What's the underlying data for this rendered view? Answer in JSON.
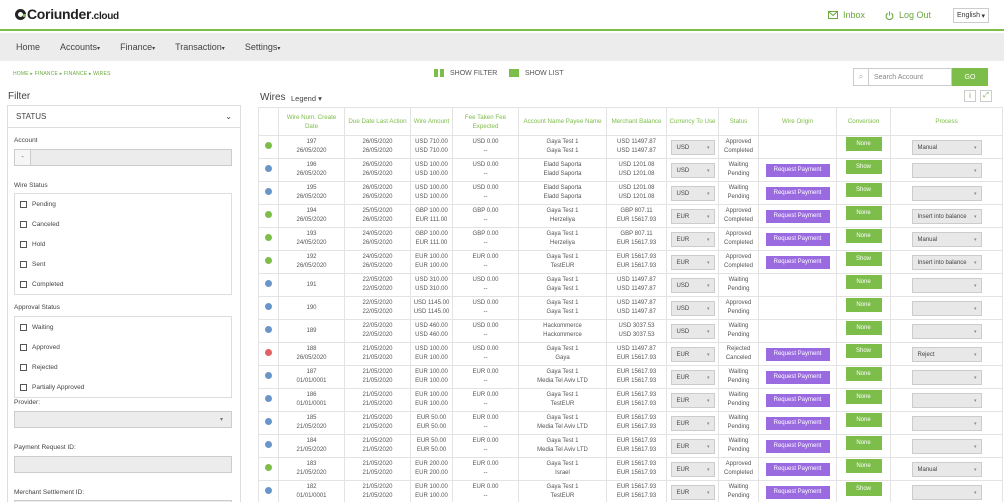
{
  "brand": {
    "name": "Coriunder",
    "suffix": ".cloud"
  },
  "header": {
    "inbox": "Inbox",
    "logout": "Log Out",
    "language": "English"
  },
  "nav": [
    "Home",
    "Accounts",
    "Finance",
    "Transaction",
    "Settings"
  ],
  "breadcrumb": "HOME  ▸  FINANCE  ▸  FINANCE  ▸  WIRES",
  "toolbar": {
    "show_filter": "SHOW FILTER",
    "show_list": "SHOW LIST",
    "search_placeholder": "Search Account",
    "go": "GO"
  },
  "filter": {
    "title": "Filter",
    "status_header": "STATUS",
    "account_label": "Account",
    "wire_status_label": "Wire Status",
    "wire_status_options": [
      "Pending",
      "Canceled",
      "Hold",
      "Sent",
      "Completed"
    ],
    "approval_status_label": "Approval Status",
    "approval_status_options": [
      "Waiting",
      "Approved",
      "Rejected",
      "Partially Approved"
    ],
    "provider_label": "Provider:",
    "payment_request_label": "Payment Request ID:",
    "merchant_settlement_label": "Merchant Settlement ID:"
  },
  "wires": {
    "title": "Wires",
    "legend": "Legend",
    "columns": [
      "",
      "Wire Num. Create Date",
      "Due Date Last Action",
      "Wire Amount",
      "Fee Taken Fee Expected",
      "Account Name Payee Name",
      "Merchant Balance",
      "Currency To Use",
      "Status",
      "Wire Origin",
      "Conversion",
      "Process"
    ],
    "rows": [
      {
        "dot": "green",
        "num": "197",
        "created": "26/05/2020",
        "due": "26/05/2020",
        "last": "26/05/2020",
        "amt1": "USD 710.00",
        "amt2": "USD 710.00",
        "fee1": "USD 0.00",
        "fee2": "--",
        "acc": "Gaya Test 1",
        "payee": "Gaya Test 1",
        "bal1": "USD 11497.87",
        "bal2": "USD 11497.87",
        "cur": "USD",
        "status1": "Approved",
        "status2": "Completed",
        "origin": "",
        "conv": "None",
        "process": "Manual"
      },
      {
        "dot": "blue",
        "num": "196",
        "created": "26/05/2020",
        "due": "26/05/2020",
        "last": "26/05/2020",
        "amt1": "USD 100.00",
        "amt2": "USD 100.00",
        "fee1": "USD 0.00",
        "fee2": "--",
        "acc": "Eladd Saporta",
        "payee": "Eladd Saporta",
        "bal1": "USD 1201.08",
        "bal2": "USD 1201.08",
        "cur": "USD",
        "status1": "Waiting",
        "status2": "Pending",
        "origin": "Request Payment",
        "conv": "Show",
        "process": ""
      },
      {
        "dot": "blue",
        "num": "195",
        "created": "26/05/2020",
        "due": "26/05/2020",
        "last": "26/05/2020",
        "amt1": "USD 100.00",
        "amt2": "USD 100.00",
        "fee1": "USD 0.00",
        "fee2": "--",
        "acc": "Eladd Saporta",
        "payee": "Eladd Saporta",
        "bal1": "USD 1201.08",
        "bal2": "USD 1201.08",
        "cur": "USD",
        "status1": "Waiting",
        "status2": "Pending",
        "origin": "Request Payment",
        "conv": "Show",
        "process": ""
      },
      {
        "dot": "green",
        "num": "194",
        "created": "26/05/2020",
        "due": "25/05/2020",
        "last": "26/05/2020",
        "amt1": "GBP 100.00",
        "amt2": "EUR 111.00",
        "fee1": "GBP 0.00",
        "fee2": "--",
        "acc": "Gaya Test 1",
        "payee": "Herzeliya",
        "bal1": "GBP 807.11",
        "bal2": "EUR 15617.93",
        "cur": "EUR",
        "status1": "Approved",
        "status2": "Completed",
        "origin": "Request Payment",
        "conv": "None",
        "process": "Insert into balance"
      },
      {
        "dot": "green",
        "num": "193",
        "created": "24/05/2020",
        "due": "24/05/2020",
        "last": "26/05/2020",
        "amt1": "GBP 100.00",
        "amt2": "EUR 111.00",
        "fee1": "GBP 0.00",
        "fee2": "--",
        "acc": "Gaya Test 1",
        "payee": "Herzeliya",
        "bal1": "GBP 807.11",
        "bal2": "EUR 15617.93",
        "cur": "EUR",
        "status1": "Approved",
        "status2": "Completed",
        "origin": "Request Payment",
        "conv": "None",
        "process": "Manual"
      },
      {
        "dot": "green",
        "num": "192",
        "created": "26/05/2020",
        "due": "24/05/2020",
        "last": "26/05/2020",
        "amt1": "EUR 100.00",
        "amt2": "EUR 100.00",
        "fee1": "EUR 0.00",
        "fee2": "--",
        "acc": "Gaya Test 1",
        "payee": "TestEUR",
        "bal1": "EUR 15617.93",
        "bal2": "EUR 15617.93",
        "cur": "EUR",
        "status1": "Approved",
        "status2": "Completed",
        "origin": "Request Payment",
        "conv": "Show",
        "process": "Insert into balance"
      },
      {
        "dot": "blue",
        "num": "191",
        "created": "",
        "due": "22/05/2020",
        "last": "22/05/2020",
        "amt1": "USD 310.00",
        "amt2": "USD 310.00",
        "fee1": "USD 0.00",
        "fee2": "--",
        "acc": "Gaya Test 1",
        "payee": "Gaya Test 1",
        "bal1": "USD 11497.87",
        "bal2": "USD 11497.87",
        "cur": "USD",
        "status1": "Waiting",
        "status2": "Pending",
        "origin": "",
        "conv": "None",
        "process": ""
      },
      {
        "dot": "blue",
        "num": "190",
        "created": "",
        "due": "22/05/2020",
        "last": "22/05/2020",
        "amt1": "USD 1145.00",
        "amt2": "USD 1145.00",
        "fee1": "USD 0.00",
        "fee2": "--",
        "acc": "Gaya Test 1",
        "payee": "Gaya Test 1",
        "bal1": "USD 11497.87",
        "bal2": "USD 11497.87",
        "cur": "USD",
        "status1": "Approved",
        "status2": "Pending",
        "origin": "",
        "conv": "None",
        "process": ""
      },
      {
        "dot": "blue",
        "num": "189",
        "created": "",
        "due": "22/05/2020",
        "last": "22/05/2020",
        "amt1": "USD 460.00",
        "amt2": "USD 460.00",
        "fee1": "USD 0.00",
        "fee2": "--",
        "acc": "Hackommerce",
        "payee": "Hackommerce",
        "bal1": "USD 3037.53",
        "bal2": "USD 3037.53",
        "cur": "USD",
        "status1": "Waiting",
        "status2": "Pending",
        "origin": "",
        "conv": "None",
        "process": ""
      },
      {
        "dot": "red",
        "num": "188",
        "created": "26/05/2020",
        "due": "21/05/2020",
        "last": "21/05/2020",
        "amt1": "USD 100.00",
        "amt2": "EUR 100.00",
        "fee1": "USD 0.00",
        "fee2": "--",
        "acc": "Gaya Test 1",
        "payee": "Gaya",
        "bal1": "USD 11497.87",
        "bal2": "EUR 15617.93",
        "cur": "EUR",
        "status1": "Rejected",
        "status2": "Canceled",
        "origin": "Request Payment",
        "conv": "Show",
        "process": "Reject"
      },
      {
        "dot": "blue",
        "num": "187",
        "created": "01/01/0001",
        "due": "21/05/2020",
        "last": "21/05/2020",
        "amt1": "EUR 100.00",
        "amt2": "EUR 100.00",
        "fee1": "EUR 0.00",
        "fee2": "--",
        "acc": "Gaya Test 1",
        "payee": "Media Tel Aviv LTD",
        "bal1": "EUR 15617.93",
        "bal2": "EUR 15617.93",
        "cur": "EUR",
        "status1": "Waiting",
        "status2": "Pending",
        "origin": "Request Payment",
        "conv": "None",
        "process": ""
      },
      {
        "dot": "blue",
        "num": "186",
        "created": "01/01/0001",
        "due": "21/05/2020",
        "last": "21/05/2020",
        "amt1": "EUR 100.00",
        "amt2": "EUR 100.00",
        "fee1": "EUR 0.00",
        "fee2": "--",
        "acc": "Gaya Test 1",
        "payee": "TestEUR",
        "bal1": "EUR 15617.93",
        "bal2": "EUR 15617.93",
        "cur": "EUR",
        "status1": "Waiting",
        "status2": "Pending",
        "origin": "Request Payment",
        "conv": "None",
        "process": ""
      },
      {
        "dot": "blue",
        "num": "185",
        "created": "21/05/2020",
        "due": "21/05/2020",
        "last": "21/05/2020",
        "amt1": "EUR 50.00",
        "amt2": "EUR 50.00",
        "fee1": "EUR 0.00",
        "fee2": "--",
        "acc": "Gaya Test 1",
        "payee": "Media Tel Aviv LTD",
        "bal1": "EUR 15617.93",
        "bal2": "EUR 15617.93",
        "cur": "EUR",
        "status1": "Waiting",
        "status2": "Pending",
        "origin": "Request Payment",
        "conv": "None",
        "process": ""
      },
      {
        "dot": "blue",
        "num": "184",
        "created": "21/05/2020",
        "due": "21/05/2020",
        "last": "21/05/2020",
        "amt1": "EUR 50.00",
        "amt2": "EUR 50.00",
        "fee1": "EUR 0.00",
        "fee2": "--",
        "acc": "Gaya Test 1",
        "payee": "Media Tel Aviv LTD",
        "bal1": "EUR 15617.93",
        "bal2": "EUR 15617.93",
        "cur": "EUR",
        "status1": "Waiting",
        "status2": "Pending",
        "origin": "Request Payment",
        "conv": "None",
        "process": ""
      },
      {
        "dot": "green",
        "num": "183",
        "created": "21/05/2020",
        "due": "21/05/2020",
        "last": "21/05/2020",
        "amt1": "EUR 200.00",
        "amt2": "EUR 200.00",
        "fee1": "EUR 0.00",
        "fee2": "--",
        "acc": "Gaya Test 1",
        "payee": "Israel",
        "bal1": "EUR 15617.93",
        "bal2": "EUR 15617.93",
        "cur": "EUR",
        "status1": "Approved",
        "status2": "Completed",
        "origin": "Request Payment",
        "conv": "None",
        "process": "Manual"
      },
      {
        "dot": "blue",
        "num": "182",
        "created": "01/01/0001",
        "due": "21/05/2020",
        "last": "21/05/2020",
        "amt1": "EUR 100.00",
        "amt2": "EUR 100.00",
        "fee1": "EUR 0.00",
        "fee2": "--",
        "acc": "Gaya Test 1",
        "payee": "TestEUR",
        "bal1": "EUR 15617.93",
        "bal2": "EUR 15617.93",
        "cur": "EUR",
        "status1": "Waiting",
        "status2": "Pending",
        "origin": "Request Payment",
        "conv": "Show",
        "process": ""
      }
    ]
  },
  "colors": {
    "accent": "#7dbd4a",
    "request_button": "#9a6ae0",
    "dot_green": "#7dbd4a",
    "dot_blue": "#6a95c8",
    "dot_red": "#e06262"
  }
}
